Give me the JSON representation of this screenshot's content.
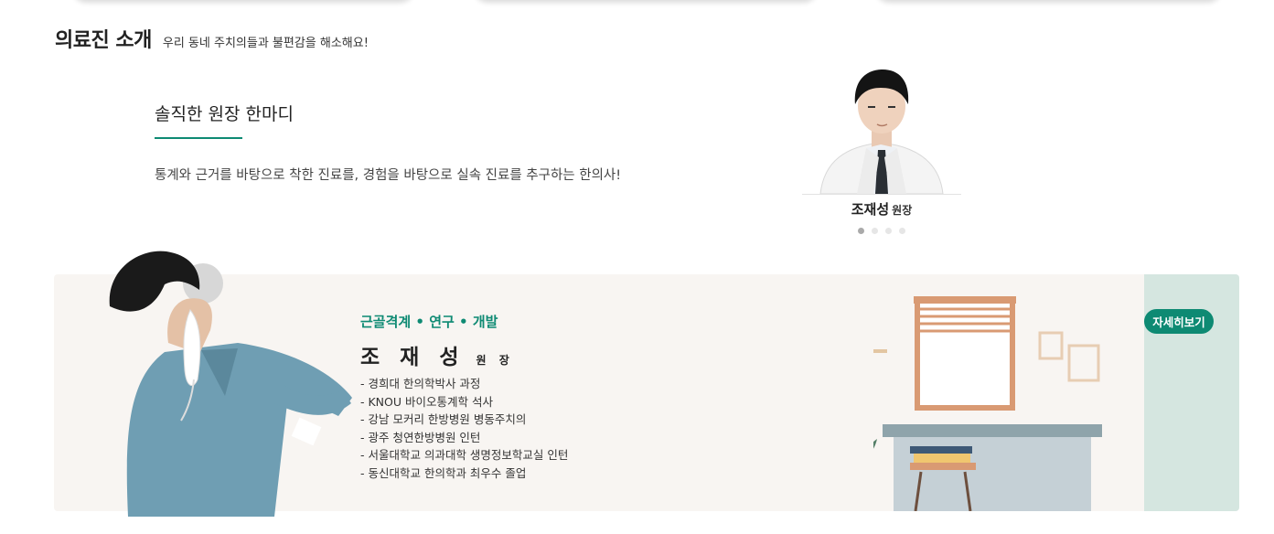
{
  "section": {
    "title": "의료진 소개",
    "subtitle": "우리 동네 주치의들과 불편감을 해소해요!"
  },
  "quote": {
    "title": "솔직한 원장 한마디",
    "text": "통계와 근거를 바탕으로 착한 진료를, 경험을 바탕으로 실속 진료를 추구하는 한의사!"
  },
  "doctor_card": {
    "name": "조재성",
    "role": "원장",
    "slide_count": 4,
    "active_slide": 1
  },
  "banner": {
    "tag": "근골격계 • 연구 • 개발",
    "name": "조 재 성",
    "role": "원 장",
    "career": [
      "- 경희대 한의학박사 과정",
      "- KNOU 바이오통계학 석사",
      "- 강남 모커리 한방병원 병동주치의",
      "- 광주 청연한방병원 인턴",
      "- 서울대학교 의과대학 생명정보학교실 인턴",
      "- 동신대학교 한의학과 최우수 졸업"
    ],
    "detail_button": "자세히보기"
  },
  "colors": {
    "accent": "#0e8a73",
    "banner_bg": "#f8f5f2"
  }
}
